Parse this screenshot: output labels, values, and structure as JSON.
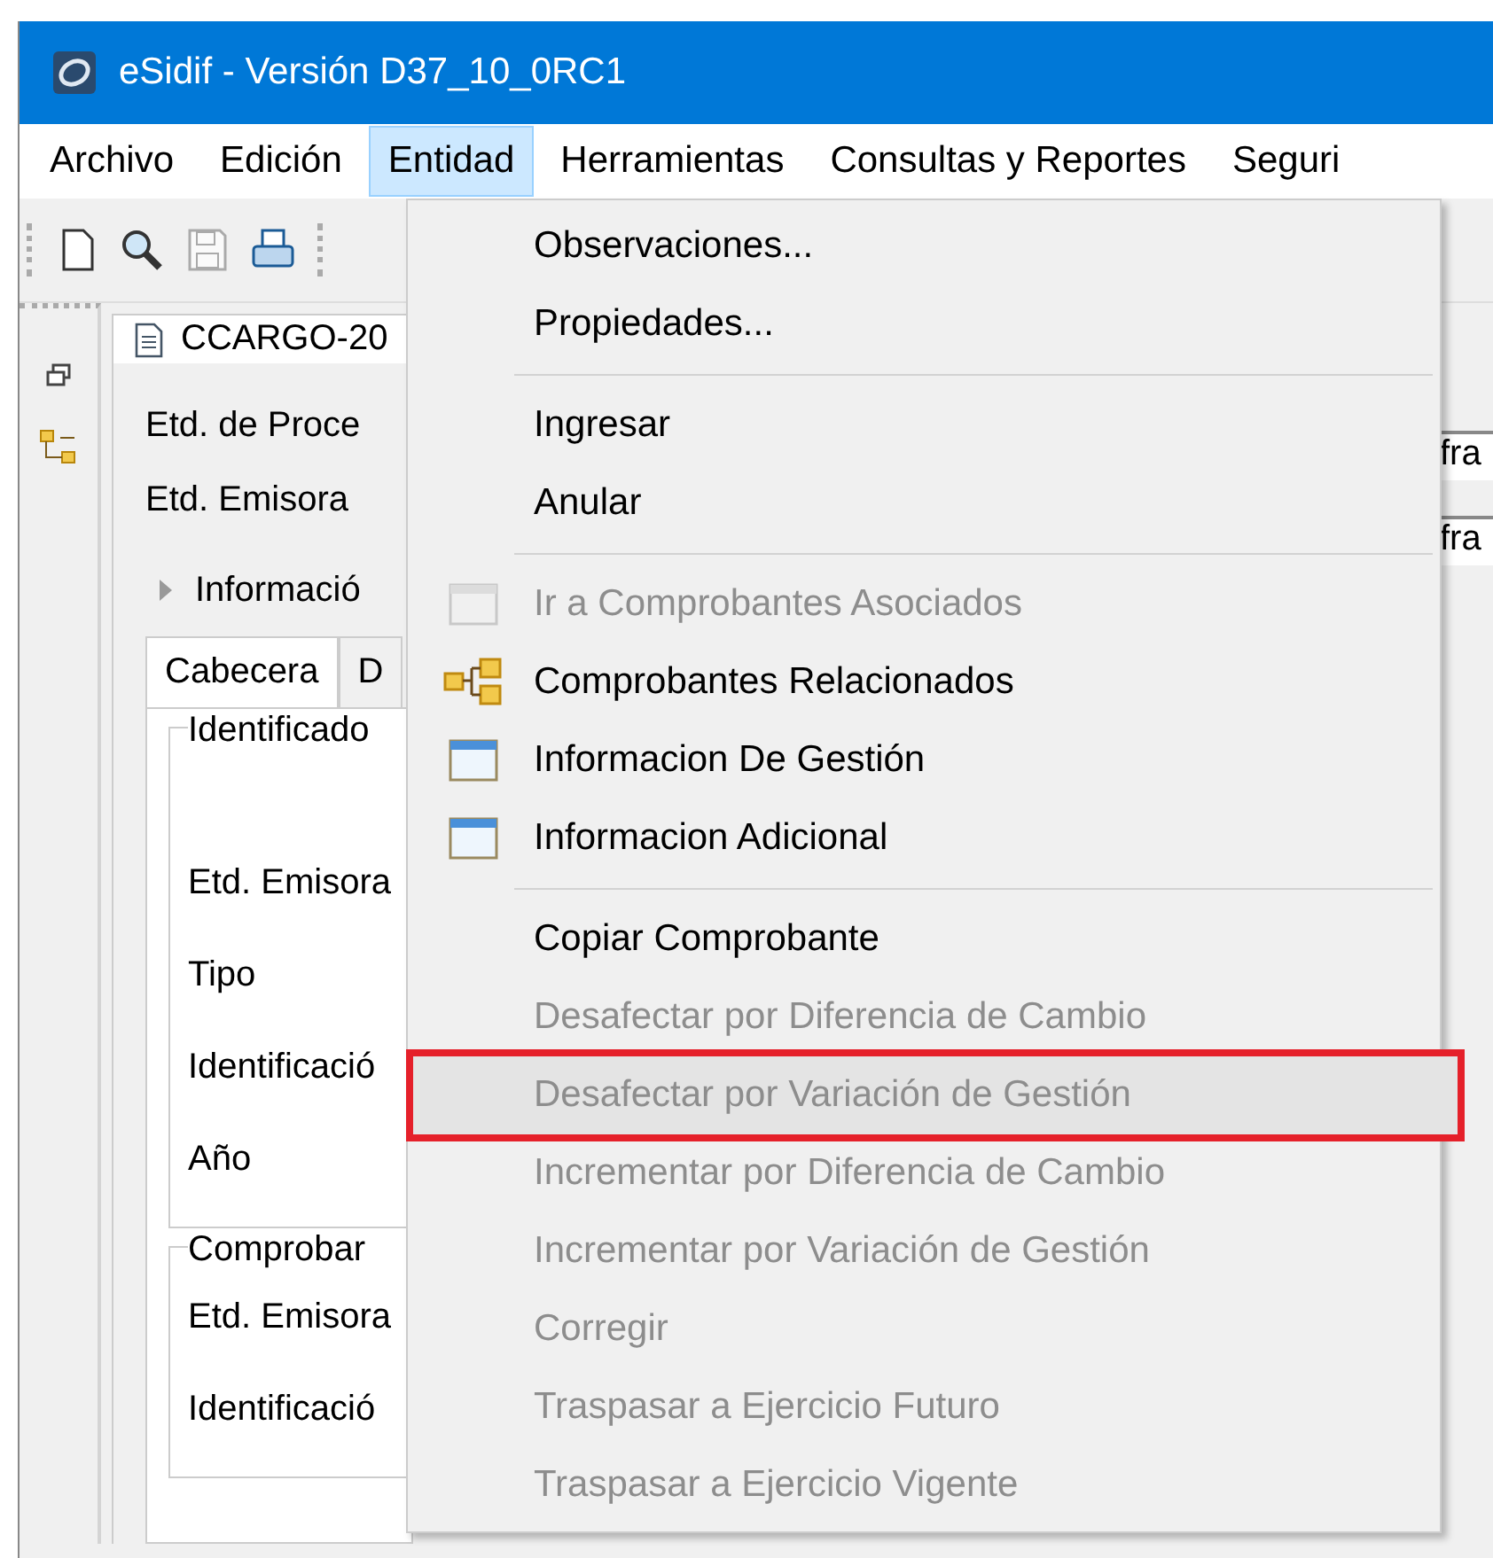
{
  "window": {
    "title": "eSidif - Versión D37_10_0RC1"
  },
  "menu_bar": [
    {
      "label": "Archivo",
      "selected": false
    },
    {
      "label": "Edición",
      "selected": false
    },
    {
      "label": "Entidad",
      "selected": true
    },
    {
      "label": "Herramientas",
      "selected": false
    },
    {
      "label": "Consultas y Reportes",
      "selected": false
    },
    {
      "label": "Seguri",
      "selected": false
    }
  ],
  "toolbar": [
    {
      "kind": "new",
      "disabled": false
    },
    {
      "kind": "search",
      "disabled": false
    },
    {
      "kind": "save",
      "disabled": true
    },
    {
      "kind": "print",
      "disabled": false
    }
  ],
  "editor": {
    "tab": "CCARGO-20",
    "top_fields": [
      {
        "label": "Etd. de Proce",
        "value": "fra"
      },
      {
        "label": "Etd. Emisora",
        "value": "fra"
      }
    ],
    "expander": {
      "label": "Informació",
      "expanded": false
    },
    "tabs": [
      {
        "label": "Cabecera",
        "selected": true
      },
      {
        "label": "D",
        "selected": false
      }
    ],
    "groups": [
      {
        "title": "Identificado",
        "labels": [
          "Etd. Emisora",
          "Tipo",
          "Identificació",
          "Año"
        ]
      },
      {
        "title": "Comprobar",
        "labels": [
          "Etd. Emisora",
          "Identificació"
        ]
      }
    ]
  },
  "dropdown_menu": {
    "groups": [
      [
        {
          "label": "Observaciones...",
          "kind": "plain",
          "disabled": false,
          "highlighted": false
        },
        {
          "label": "Propiedades...",
          "kind": "plain",
          "disabled": false,
          "highlighted": false
        }
      ],
      [
        {
          "label": "Ingresar",
          "kind": "plain",
          "disabled": false,
          "highlighted": false
        },
        {
          "label": "Anular",
          "kind": "plain",
          "disabled": false,
          "highlighted": false
        }
      ],
      [
        {
          "label": "Ir a Comprobantes Asociados",
          "kind": "window",
          "disabled": true,
          "highlighted": false
        },
        {
          "label": "Comprobantes Relacionados",
          "kind": "tree",
          "disabled": false,
          "highlighted": false
        },
        {
          "label": "Informacion De Gestión",
          "kind": "window",
          "disabled": false,
          "highlighted": false
        },
        {
          "label": "Informacion Adicional",
          "kind": "window",
          "disabled": false,
          "highlighted": false
        }
      ],
      [
        {
          "label": "Copiar Comprobante",
          "kind": "plain",
          "disabled": false,
          "highlighted": false
        },
        {
          "label": "Desafectar por Diferencia de Cambio",
          "kind": "plain",
          "disabled": true,
          "highlighted": false
        },
        {
          "label": "Desafectar por Variación de Gestión",
          "kind": "plain",
          "disabled": true,
          "highlighted": true
        },
        {
          "label": "Incrementar por Diferencia de Cambio",
          "kind": "plain",
          "disabled": true,
          "highlighted": false
        },
        {
          "label": "Incrementar por Variación de Gestión",
          "kind": "plain",
          "disabled": true,
          "highlighted": false
        },
        {
          "label": "Corregir",
          "kind": "plain",
          "disabled": true,
          "highlighted": false
        },
        {
          "label": "Traspasar a Ejercicio Futuro",
          "kind": "plain",
          "disabled": true,
          "highlighted": false
        },
        {
          "label": "Traspasar a Ejercicio Vigente",
          "kind": "plain",
          "disabled": true,
          "highlighted": false
        }
      ]
    ]
  }
}
